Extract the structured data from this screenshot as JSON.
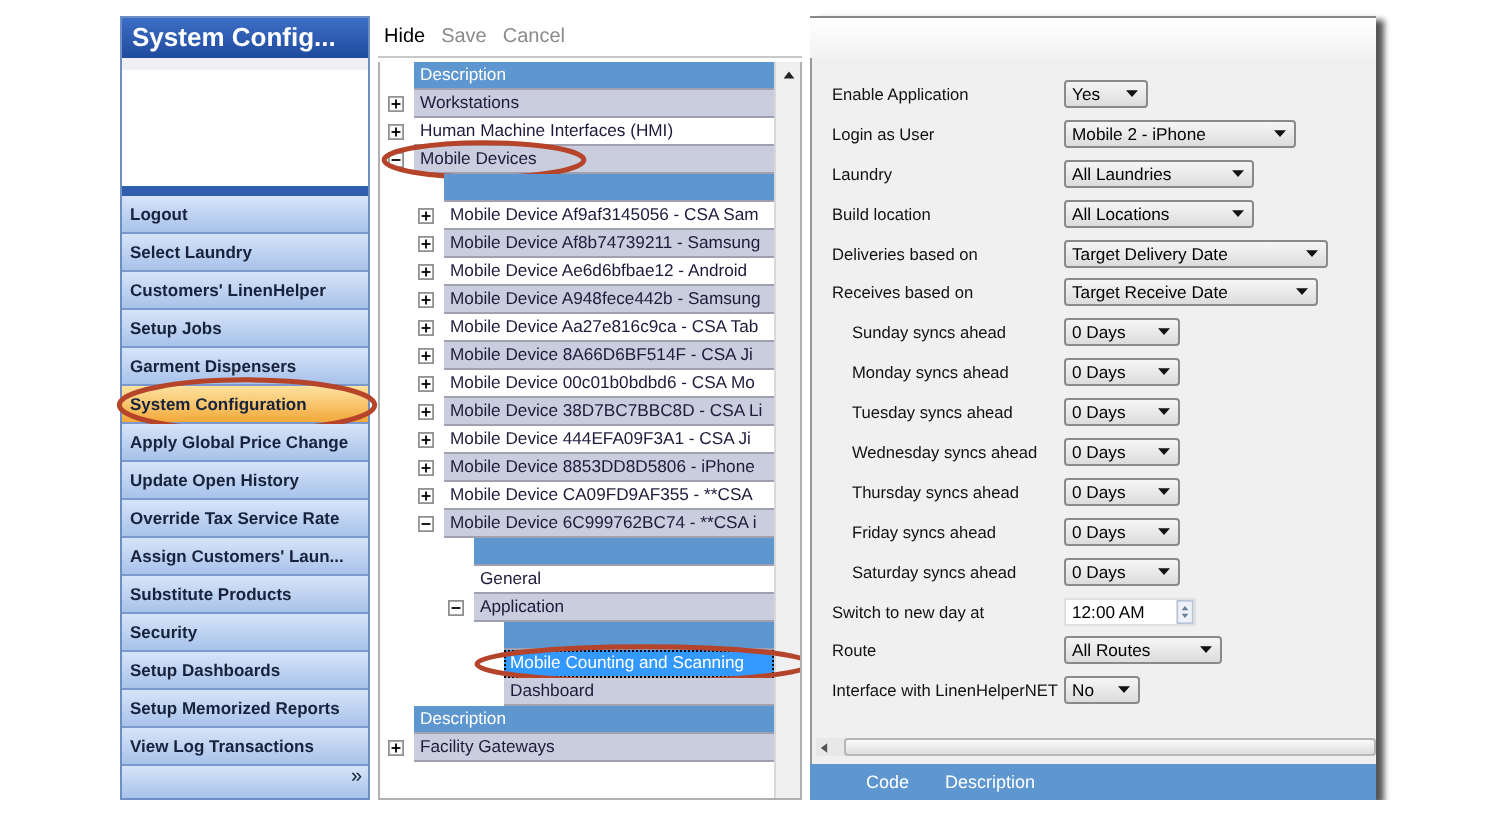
{
  "sidebar": {
    "title": "System Config...",
    "items": [
      {
        "label": "Logout",
        "selected": false
      },
      {
        "label": "Select Laundry",
        "selected": false
      },
      {
        "label": "Customers' LinenHelper",
        "selected": false
      },
      {
        "label": "Setup Jobs",
        "selected": false
      },
      {
        "label": "Garment Dispensers",
        "selected": false
      },
      {
        "label": "System Configuration",
        "selected": true,
        "circled": true
      },
      {
        "label": "Apply Global Price Change",
        "selected": false
      },
      {
        "label": "Update Open History",
        "selected": false
      },
      {
        "label": "Override Tax Service Rate",
        "selected": false
      },
      {
        "label": "Assign Customers' Laun...",
        "selected": false
      },
      {
        "label": "Substitute Products",
        "selected": false
      },
      {
        "label": "Security",
        "selected": false
      },
      {
        "label": "Setup Dashboards",
        "selected": false
      },
      {
        "label": "Setup Memorized Reports",
        "selected": false
      },
      {
        "label": "View Log Transactions",
        "selected": false
      }
    ],
    "overflow": "»"
  },
  "toolbar": [
    {
      "label": "Hide",
      "disabled": false
    },
    {
      "label": "Save",
      "disabled": true
    },
    {
      "label": "Cancel",
      "disabled": true
    }
  ],
  "tree": {
    "header": "Description",
    "rows": [
      {
        "text": "Workstations",
        "expanded": false,
        "selected": false
      },
      {
        "text": "Human Machine Interfaces (HMI)",
        "expanded": false,
        "selected": false
      },
      {
        "text": "Mobile Devices",
        "expanded": true,
        "selected": false,
        "circled": true,
        "children": [
          {
            "text": "Mobile Device Af9af3145056 - CSA Sam",
            "expanded": false,
            "selected": false
          },
          {
            "text": "Mobile Device Af8b74739211 - Samsung",
            "expanded": false,
            "selected": false
          },
          {
            "text": "Mobile Device Ae6d6bfbae12 - Android",
            "expanded": false,
            "selected": false
          },
          {
            "text": "Mobile Device A948fece442b - Samsung",
            "expanded": false,
            "selected": false
          },
          {
            "text": "Mobile Device Aa27e816c9ca - CSA Tab",
            "expanded": false,
            "selected": false
          },
          {
            "text": "Mobile Device 8A66D6BF514F - CSA Ji",
            "expanded": false,
            "selected": false
          },
          {
            "text": "Mobile Device 00c01b0bdbd6 - CSA Mo",
            "expanded": false,
            "selected": false
          },
          {
            "text": "Mobile Device 38D7BC7BBC8D - CSA Li",
            "expanded": false,
            "selected": false
          },
          {
            "text": "Mobile Device 444EFA09F3A1 - CSA Ji",
            "expanded": false,
            "selected": false
          },
          {
            "text": "Mobile Device 8853DD8D5806 - iPhone",
            "expanded": false,
            "selected": false
          },
          {
            "text": "Mobile Device CA09FD9AF355 - **CSA",
            "expanded": false,
            "selected": false
          },
          {
            "text": "Mobile Device 6C999762BC74 - **CSA i",
            "expanded": true,
            "selected": false,
            "children": [
              {
                "text": "General",
                "selected": false
              },
              {
                "text": "Application",
                "expanded": true,
                "selected": false,
                "children": [
                  {
                    "text": "Mobile Counting and Scanning",
                    "selected": true,
                    "circled": true
                  },
                  {
                    "text": "Dashboard",
                    "selected": false
                  }
                ]
              }
            ]
          }
        ]
      }
    ]
  },
  "tree_lower": {
    "header": "Description",
    "rows": [
      {
        "text": "Facility Gateways",
        "expanded": false,
        "selected": false
      }
    ]
  },
  "form": [
    {
      "label": "Enable Application",
      "value": "Yes",
      "kind": "dropdown",
      "indented": false
    },
    {
      "label": "Login as User",
      "value": "Mobile 2 - iPhone",
      "kind": "dropdown",
      "indented": false
    },
    {
      "label": "Laundry",
      "value": "All Laundries",
      "kind": "dropdown",
      "indented": false
    },
    {
      "label": "Build location",
      "value": "All Locations",
      "kind": "dropdown",
      "indented": false
    },
    {
      "label": "Deliveries based on",
      "value": "Target Delivery Date",
      "kind": "dropdown",
      "indented": false
    },
    {
      "label": "Receives based on",
      "value": "Target Receive Date",
      "kind": "dropdown",
      "indented": false
    },
    {
      "label": "Sunday syncs ahead",
      "value": "0 Days",
      "kind": "dropdown",
      "indented": true
    },
    {
      "label": "Monday syncs ahead",
      "value": "0 Days",
      "kind": "dropdown",
      "indented": true
    },
    {
      "label": "Tuesday syncs ahead",
      "value": "0 Days",
      "kind": "dropdown",
      "indented": true
    },
    {
      "label": "Wednesday syncs ahead",
      "value": "0 Days",
      "kind": "dropdown",
      "indented": true
    },
    {
      "label": "Thursday syncs ahead",
      "value": "0 Days",
      "kind": "dropdown",
      "indented": true
    },
    {
      "label": "Friday syncs ahead",
      "value": "0 Days",
      "kind": "dropdown",
      "indented": true
    },
    {
      "label": "Saturday syncs ahead",
      "value": "0 Days",
      "kind": "dropdown",
      "indented": true
    },
    {
      "label": "Switch to new day at",
      "value": "12:00 AM",
      "kind": "time",
      "indented": false
    },
    {
      "label": "Route",
      "value": "All Routes",
      "kind": "dropdown",
      "indented": false
    },
    {
      "label": "Interface with LinenHelperNET",
      "value": "No",
      "kind": "dropdown",
      "indented": false
    }
  ],
  "bottom_grid": {
    "columns": [
      "Code",
      "Description"
    ]
  }
}
